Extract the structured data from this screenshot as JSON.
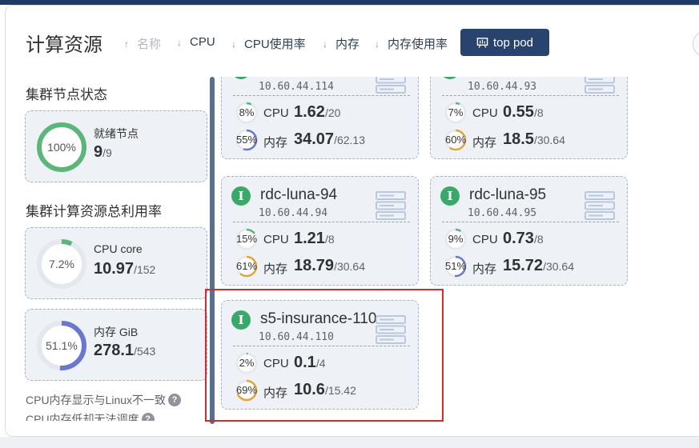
{
  "header": {
    "title": "计算资源",
    "sorts": [
      {
        "label": "名称",
        "enabled": false
      },
      {
        "label": "CPU",
        "enabled": true
      },
      {
        "label": "CPU使用率",
        "enabled": true
      },
      {
        "label": "内存",
        "enabled": true
      },
      {
        "label": "内存使用率",
        "enabled": true
      }
    ],
    "top_pod_label": "top pod"
  },
  "cluster_nodes": {
    "section_title": "集群节点状态",
    "ring_text": "100%",
    "ratio": 1.0,
    "label": "就绪节点",
    "value": "9",
    "total": "/9",
    "color": "#5bb779"
  },
  "cluster_usage": {
    "section_title": "集群计算资源总利用率",
    "cpu": {
      "ring_text": "7.2%",
      "ratio": 0.072,
      "label": "CPU core",
      "value": "10.97",
      "total": "/152",
      "color": "#5bb779"
    },
    "mem": {
      "ring_text": "51.1%",
      "ratio": 0.511,
      "label": "内存 GiB",
      "value": "278.1",
      "total": "/543",
      "color": "#6b77cf"
    }
  },
  "notes": [
    "CPU内存显示与Linux不一致",
    "CPU内存低却无法调度"
  ],
  "nodes": [
    {
      "name": "",
      "ip": "10.60.44.114",
      "cpu_pct": "8%",
      "cpu_ratio": 0.08,
      "cpu_value": "1.62",
      "cpu_total": "/20",
      "mem_pct": "55%",
      "mem_ratio": 0.55,
      "mem_value": "34.07",
      "mem_total": "/62.13",
      "mem_color": "#6b77cf"
    },
    {
      "name": "",
      "ip": "10.60.44.93",
      "cpu_pct": "7%",
      "cpu_ratio": 0.07,
      "cpu_value": "0.55",
      "cpu_total": "/8",
      "mem_pct": "60%",
      "mem_ratio": 0.6,
      "mem_value": "18.5",
      "mem_total": "/30.64",
      "mem_color": "#e0a43a"
    },
    {
      "name": "rdc-luna-94",
      "ip": "10.60.44.94",
      "cpu_pct": "15%",
      "cpu_ratio": 0.15,
      "cpu_value": "1.21",
      "cpu_total": "/8",
      "mem_pct": "61%",
      "mem_ratio": 0.61,
      "mem_value": "18.79",
      "mem_total": "/30.64",
      "mem_color": "#e0a43a"
    },
    {
      "name": "rdc-luna-95",
      "ip": "10.60.44.95",
      "cpu_pct": "9%",
      "cpu_ratio": 0.09,
      "cpu_value": "0.73",
      "cpu_total": "/8",
      "mem_pct": "51%",
      "mem_ratio": 0.51,
      "mem_value": "15.72",
      "mem_total": "/30.64",
      "mem_color": "#6b77cf"
    },
    {
      "name": "s5-insurance-110",
      "ip": "10.60.44.110",
      "cpu_pct": "2%",
      "cpu_ratio": 0.02,
      "cpu_value": "0.1",
      "cpu_total": "/4",
      "mem_pct": "69%",
      "mem_ratio": 0.69,
      "mem_value": "10.6",
      "mem_total": "/15.42",
      "mem_color": "#e0a43a"
    }
  ],
  "labels": {
    "cpu": "CPU",
    "mem": "内存",
    "node_icon": "I"
  },
  "colors": {
    "cpu_ring": "#5bb779",
    "accent": "#27436e",
    "highlight": "#d42b2b"
  }
}
